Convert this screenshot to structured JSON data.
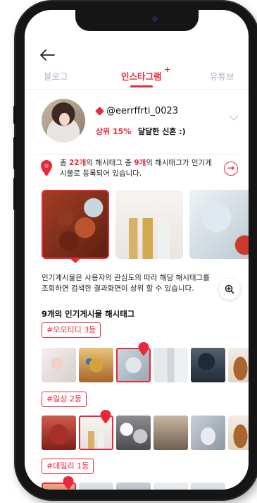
{
  "tabs": [
    {
      "label": "블로그"
    },
    {
      "label": "인스타그램"
    },
    {
      "label": "유튜브"
    }
  ],
  "tab_indicator": "+",
  "profile": {
    "username": "@eerrffrti_0023",
    "rank": "상위 15%",
    "grade": "달달한 신혼 :)"
  },
  "summary": {
    "prefix": "총 ",
    "total": "22개",
    "mid": "의 해시태그 중 ",
    "popular": "9개",
    "suffix": "의 해시태그가 인기게시물로 등록되어 있습니다."
  },
  "description": "인기게시물은 사용자의 관심도의 따라 해당 해시태그를 조회하면 검색한 결과화면이 상위 할 수 있습니다.",
  "section_title": "9개의 인기게시물 해시태그",
  "hashtags": [
    {
      "label": "#오오티디 3등"
    },
    {
      "label": "#일상 2등"
    },
    {
      "label": "#데일리 1등"
    }
  ],
  "icons": {
    "back": "arrow-left-icon",
    "expand": "chevron-down-icon",
    "pin": "location-pin-icon",
    "more": "arrow-right-circle-icon",
    "zoom": "zoom-in-icon",
    "brand": "diamond-icon"
  },
  "colors": {
    "accent": "#e8293c",
    "inactive_tab": "#aab4c2"
  }
}
